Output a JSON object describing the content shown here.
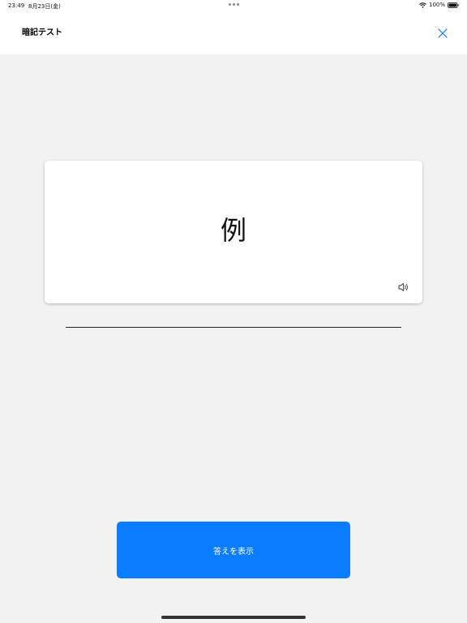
{
  "status_bar": {
    "time": "23:49",
    "date": "8月23日(金)",
    "battery_percent": "100%",
    "battery_level": 1.0
  },
  "header": {
    "title": "暗記テスト",
    "close_icon": "close-icon"
  },
  "card": {
    "word": "例",
    "speaker_icon": "speaker-icon"
  },
  "actions": {
    "show_answer_label": "答えを表示"
  },
  "colors": {
    "accent": "#0a7cff",
    "background": "#f2f2f2",
    "surface": "#ffffff"
  }
}
